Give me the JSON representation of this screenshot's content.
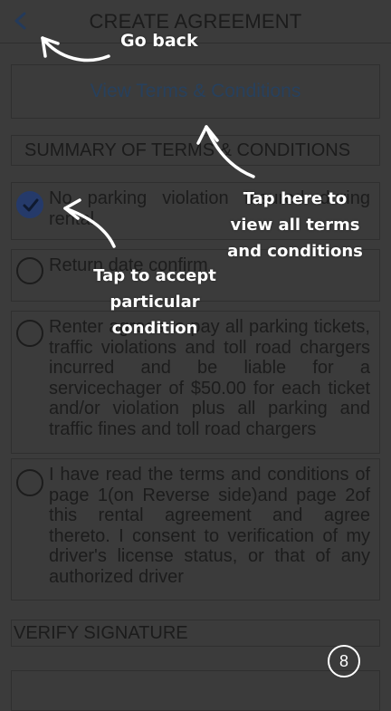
{
  "header": {
    "title": "CREATE AGREEMENT",
    "back_icon": "chevron-left-icon"
  },
  "terms": {
    "link_label": "View Terms & Conditions"
  },
  "summary": {
    "heading": "SUMMARY OF TERMS & CONDITIONS"
  },
  "conditions": [
    {
      "text": "No parking violation Insured during rental",
      "checked": true
    },
    {
      "text": "Return date confirm",
      "checked": false
    },
    {
      "text": "Renter agrees to pay all parking tickets, traffic violations and toll road chargers incurred and be liable for a servicechager of $50.00 for each ticket and/or violation plus all parking and traffic fines and toll road chargers",
      "checked": false
    },
    {
      "text": "I have read the terms and conditions of page 1(on Reverse side)and page 2of this rental agreement and agree thereto. I consent to verification of my driver's license status, or that of any authorized driver",
      "checked": false
    }
  ],
  "verify": {
    "heading": "VERIFY SIGNATURE"
  },
  "tips": {
    "back": "Go back",
    "terms": "Tap here to view all terms and conditions",
    "accept": "Tap to accept particular condition"
  },
  "step_number": "8",
  "colors": {
    "overlay": "#3b3b3b",
    "accent": "#253a6a",
    "tip_text": "#ffffff"
  }
}
